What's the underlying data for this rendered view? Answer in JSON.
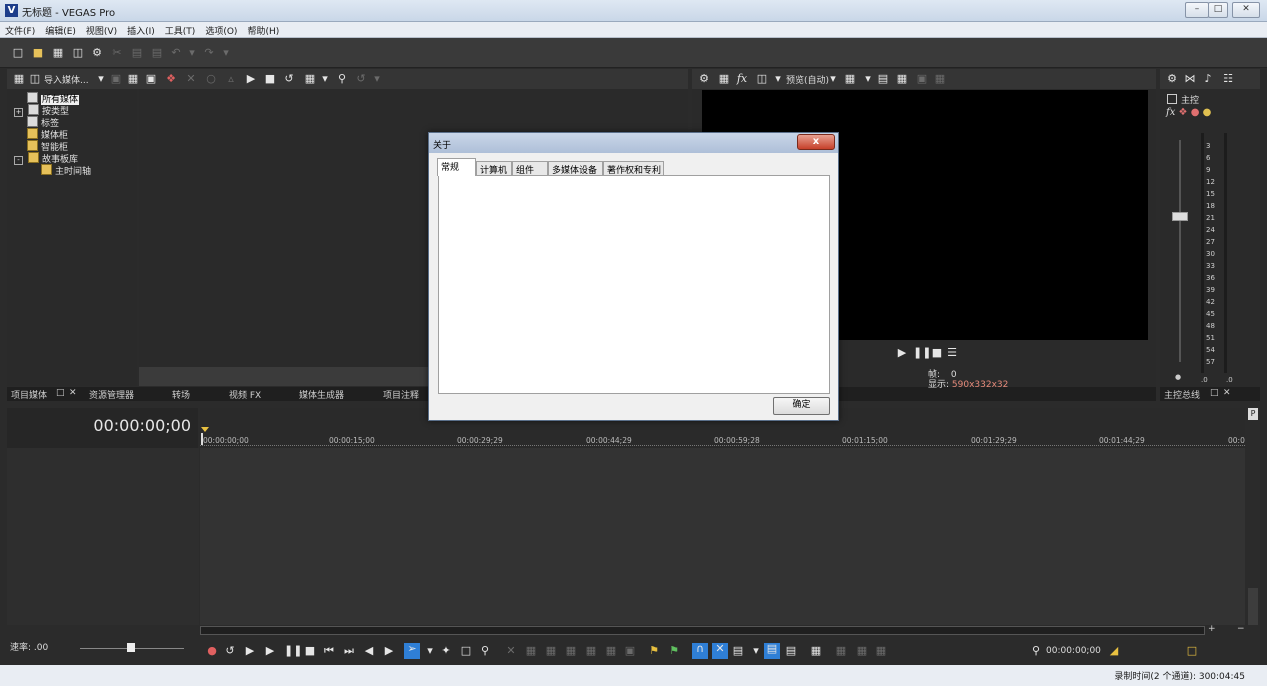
{
  "window": {
    "title": "无标题 - VEGAS Pro",
    "logo": "V"
  },
  "menu": [
    "文件(F)",
    "编辑(E)",
    "视图(V)",
    "插入(I)",
    "工具(T)",
    "选项(O)",
    "帮助(H)"
  ],
  "media_panel": {
    "import_label": "导入媒体...",
    "tree": [
      {
        "label": "所有媒体",
        "selected": true
      },
      {
        "label": "按类型"
      },
      {
        "label": "标签"
      },
      {
        "label": "媒体柜"
      },
      {
        "label": "智能柜"
      },
      {
        "label": "故事板库"
      },
      {
        "label": "主时间轴"
      }
    ],
    "tabs": [
      "项目媒体",
      "资源管理器",
      "转场",
      "视频 FX",
      "媒体生成器",
      "项目注释"
    ]
  },
  "preview": {
    "mode_label": "预览(自动)",
    "frame_label": "帧:",
    "frame_value": "0",
    "display_label": "显示:",
    "display_value": "590x332x32"
  },
  "mixer": {
    "master_label": "主控",
    "ticks": [
      "3",
      "6",
      "9",
      "12",
      "15",
      "18",
      "21",
      "24",
      "27",
      "30",
      "33",
      "36",
      "39",
      "42",
      "45",
      "48",
      "51",
      "54",
      "57"
    ],
    "left_level": ".0",
    "right_level": ".0",
    "tab_label": "主控总线"
  },
  "timeline": {
    "timecode": "00:00:00;00",
    "ruler": [
      "00:00:00;00",
      "00:00:15;00",
      "00:00:29;29",
      "00:00:44;29",
      "00:00:59;28",
      "00:01:15;00",
      "00:01:29;29",
      "00:01:44;29",
      "00:0"
    ],
    "rate_label": "速率:",
    "rate_value": ".00",
    "cursor_time": "00:00:00;00",
    "status": "录制时间(2 个通道): 300:04:45",
    "marker_label": "P"
  },
  "dialog": {
    "title": "关于",
    "close": "x",
    "tabs": [
      "常规",
      "计算机",
      "组件",
      "多媒体设备",
      "著作权和专利"
    ],
    "ok": "确定"
  },
  "colors": {
    "accent_blue": "#2f7fd6",
    "display_value": "#e58a7a",
    "marker": "#e8c040"
  }
}
